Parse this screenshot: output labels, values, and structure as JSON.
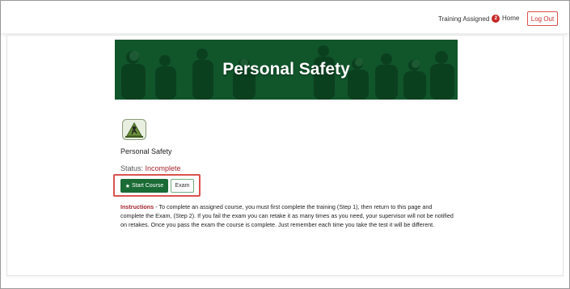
{
  "nav": {
    "training_assigned_label": "Training Assigned",
    "training_assigned_count": "2",
    "home_label": "Home",
    "logout_label": "Log Out"
  },
  "banner": {
    "title": "Personal Safety"
  },
  "course": {
    "icon": "worker-safety-icon",
    "name": "Personal Safety",
    "status_label": "Status:",
    "status_value": "Incomplete"
  },
  "actions": {
    "start_course_label": "Start Course",
    "exam_label": "Exam"
  },
  "instructions": {
    "label": "Instructions",
    "text": " - To complete an assigned course, you must first complete the training (Step 1), then return to this page and complete the Exam, (Step 2). If you fail the exam you can retake it as many times as you need, your supervisor will not be notified on retakes. Once you pass the exam the course is complete. Just remember each time you take the test it will be different."
  },
  "colors": {
    "brand_green": "#1a6b35",
    "banner_green": "#0f5a2c",
    "alert_red": "#c62828",
    "status_red": "#a4262c"
  }
}
